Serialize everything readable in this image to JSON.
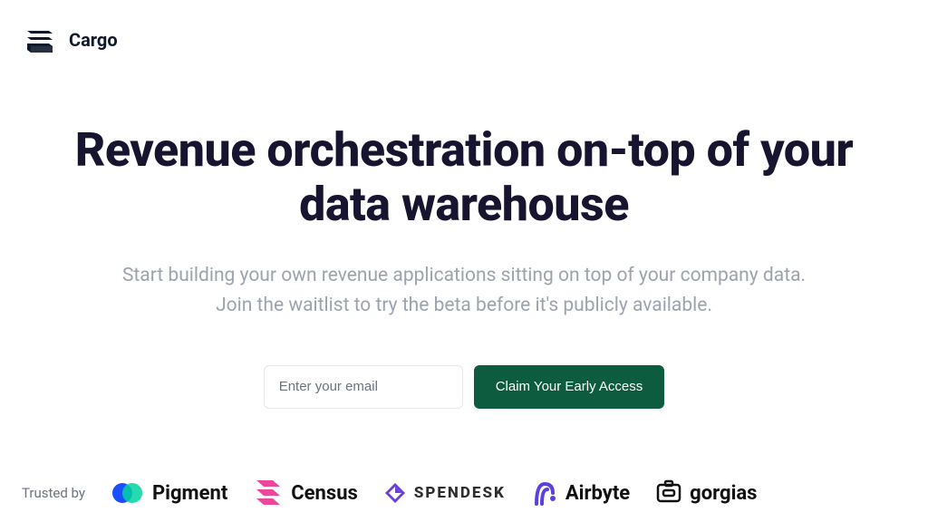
{
  "brand": {
    "name": "Cargo"
  },
  "hero": {
    "headline": "Revenue orchestration on-top of your data warehouse",
    "sub1": "Start building your own revenue applications sitting on top of your company data.",
    "sub2": "Join the waitlist to try the beta before it's publicly available."
  },
  "signup": {
    "placeholder": "Enter your email",
    "cta": "Claim Your Early Access"
  },
  "trusted": {
    "label": "Trusted by",
    "partners": {
      "pigment": "Pigment",
      "census": "Census",
      "spendesk": "SPENDESK",
      "airbyte": "Airbyte",
      "gorgias": "gorgias"
    }
  }
}
